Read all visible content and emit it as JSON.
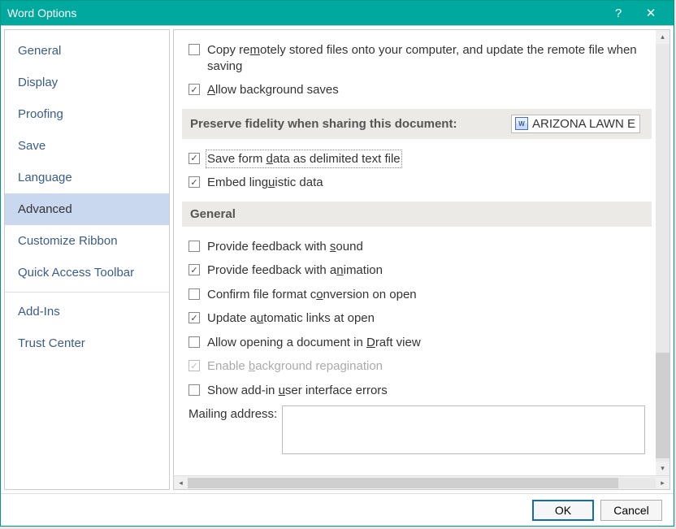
{
  "titlebar": {
    "title": "Word Options"
  },
  "sidebar": {
    "items": [
      {
        "label": "General"
      },
      {
        "label": "Display"
      },
      {
        "label": "Proofing"
      },
      {
        "label": "Save"
      },
      {
        "label": "Language"
      },
      {
        "label": "Advanced",
        "selected": true
      },
      {
        "label": "Customize Ribbon"
      },
      {
        "label": "Quick Access Toolbar"
      },
      {
        "label": "Add-Ins"
      },
      {
        "label": "Trust Center"
      }
    ]
  },
  "options": {
    "copy_remote": "Copy remotely stored files onto your computer, and update the remote file when saving",
    "allow_bg_saves": "Allow background saves",
    "preserve_header": "Preserve fidelity when sharing this document:",
    "doc_name": "ARIZONA LAWN EXP",
    "save_form_data": "Save form data as delimited text file",
    "embed_ling": "Embed linguistic data",
    "general_header": "General",
    "feedback_sound": "Provide feedback with sound",
    "feedback_anim": "Provide feedback with animation",
    "confirm_format": "Confirm file format conversion on open",
    "update_links": "Update automatic links at open",
    "draft_view": "Allow opening a document in Draft view",
    "bg_repag": "Enable background repagination",
    "addin_errors": "Show add-in user interface errors",
    "mailing_label": "Mailing address:",
    "mailing_value": ""
  },
  "footer": {
    "ok": "OK",
    "cancel": "Cancel"
  }
}
